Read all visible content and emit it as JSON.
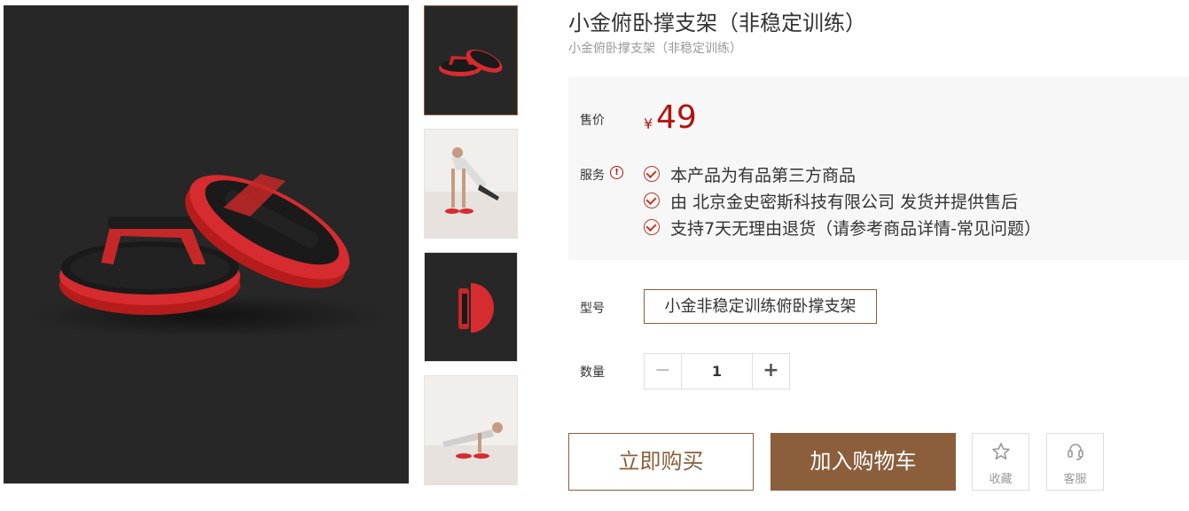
{
  "product": {
    "title": "小金俯卧撑支架（非稳定训练）",
    "subtitle": "小金俯卧撑支架（非稳定训练）"
  },
  "price": {
    "label": "售价",
    "currency": "¥",
    "value": "49"
  },
  "services": {
    "label": "服务",
    "alert_icon": "!",
    "items": [
      "本产品为有品第三方商品",
      "由 北京金史密斯科技有限公司 发货并提供售后",
      "支持7天无理由退货（请参考商品详情-常见问题）"
    ]
  },
  "model": {
    "label": "型号",
    "options": [
      "小金非稳定训练俯卧撑支架"
    ]
  },
  "quantity": {
    "label": "数量",
    "value": "1",
    "minus": "−",
    "plus": "+"
  },
  "actions": {
    "buy_now": "立即购买",
    "add_to_cart": "加入购物车",
    "favorite": "收藏",
    "service": "客服"
  },
  "gallery": {
    "thumbnail_count": 4,
    "icons": [
      "pushup-stand-main-image",
      "pushup-stand-thumb",
      "man-pushup-thumb",
      "pushup-stand-top-thumb",
      "man-pushup-side-thumb"
    ]
  },
  "colors": {
    "accent": "#8b5e3c",
    "price": "#b4120d",
    "panel_bg": "#f7f7f7",
    "product_red": "#d62b2f",
    "image_bg": "#272727"
  }
}
